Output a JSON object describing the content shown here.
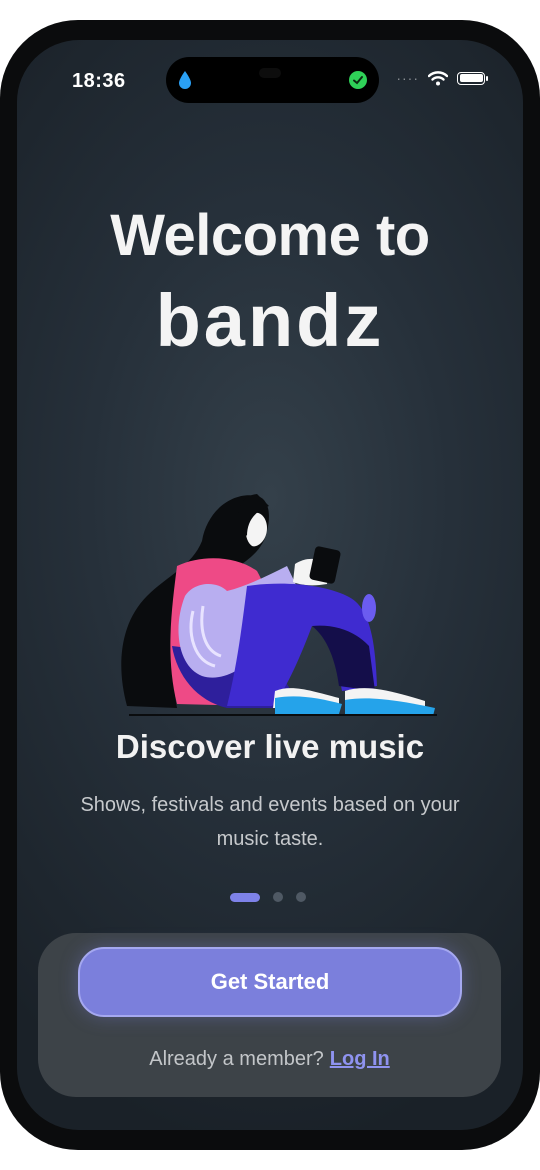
{
  "status_bar": {
    "time": "18:36",
    "icons": [
      "water-drop-icon",
      "green-check-icon",
      "signal-icon",
      "wifi-icon",
      "battery-icon"
    ],
    "signal_text": "····"
  },
  "welcome": {
    "line1": "Welcome to",
    "brand": "bandz"
  },
  "illustration": {
    "name": "woman-with-phone-illustration"
  },
  "onboarding": {
    "headline": "Discover live music",
    "subtitle": "Shows, festivals and events based on your music taste.",
    "page_indicator": {
      "total": 3,
      "current": 1
    }
  },
  "actions": {
    "primary_label": "Get Started",
    "member_prompt": "Already a member?",
    "login_label": "Log In"
  },
  "colors": {
    "accent": "#7b7fdc",
    "link": "#8f93f0",
    "background": "#26303a",
    "card": "#3d4348"
  }
}
